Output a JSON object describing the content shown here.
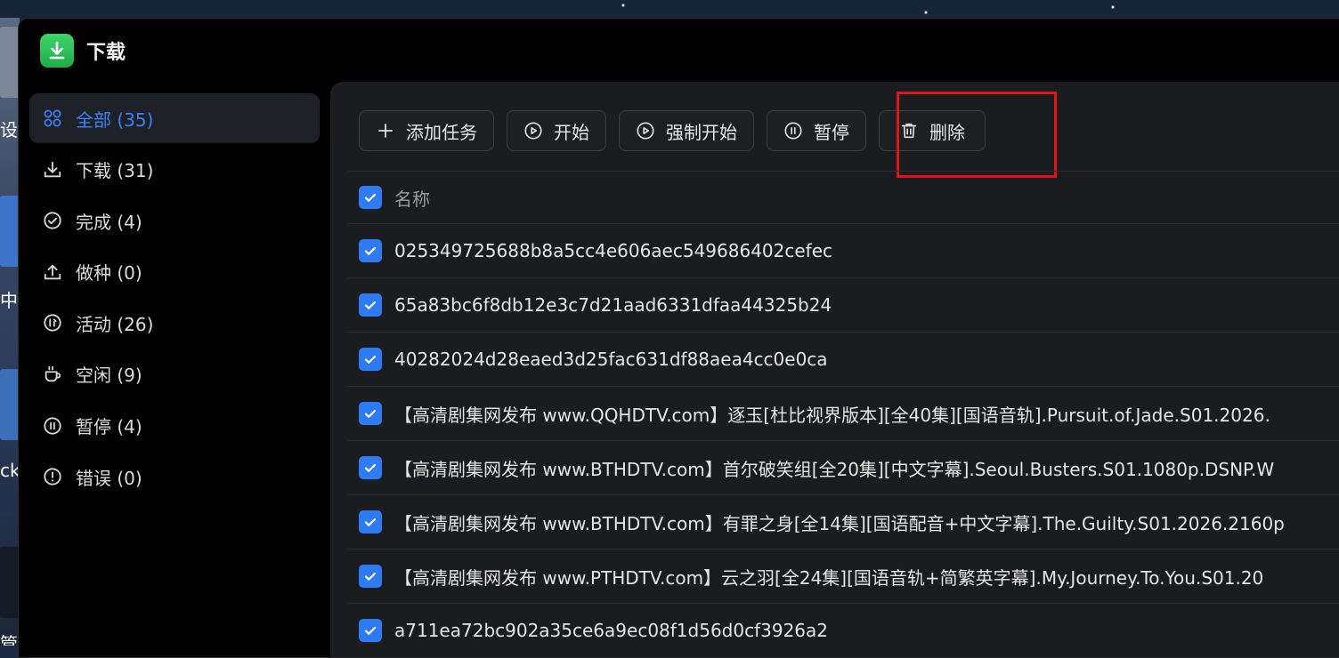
{
  "app": {
    "title": "下载"
  },
  "desktop": {
    "partial_texts": [
      "设",
      "中",
      "ck",
      "管"
    ]
  },
  "sidebar": {
    "items": [
      {
        "label": "全部 (35)",
        "icon": "grid-icon",
        "active": true
      },
      {
        "label": "下载 (31)",
        "icon": "download-icon",
        "active": false
      },
      {
        "label": "完成 (4)",
        "icon": "check-circle-icon",
        "active": false
      },
      {
        "label": "做种 (0)",
        "icon": "upload-icon",
        "active": false
      },
      {
        "label": "活动 (26)",
        "icon": "activity-icon",
        "active": false
      },
      {
        "label": "空闲 (9)",
        "icon": "coffee-cup-icon",
        "active": false
      },
      {
        "label": "暂停 (4)",
        "icon": "pause-circle-icon",
        "active": false
      },
      {
        "label": "错误 (0)",
        "icon": "alert-circle-icon",
        "active": false
      }
    ]
  },
  "toolbar": {
    "add_label": "添加任务",
    "start_label": "开始",
    "force_start_label": "强制开始",
    "pause_label": "暂停",
    "delete_label": "删除"
  },
  "table": {
    "header": "名称",
    "rows": [
      "025349725688b8a5cc4e606aec549686402cefec",
      "65a83bc6f8db12e3c7d21aad6331dfaa44325b24",
      "40282024d28eaed3d25fac631df88aea4cc0e0ca",
      "【高清剧集网发布 www.QQHDTV.com】逐玉[杜比视界版本][全40集][国语音轨].Pursuit.of.Jade.S01.2026.",
      "【高清剧集网发布 www.BTHDTV.com】首尔破笑组[全20集][中文字幕].Seoul.Busters.S01.1080p.DSNP.W",
      "【高清剧集网发布 www.BTHDTV.com】有罪之身[全14集][国语配音+中文字幕].The.Guilty.S01.2026.2160p",
      "【高清剧集网发布 www.PTHDTV.com】云之羽[全24集][国语音轨+简繁英字幕].My.Journey.To.You.S01.20",
      "a711ea72bc902a35ce6a9ec08f1d56d0cf3926a2"
    ]
  },
  "colors": {
    "accent": "#2f7bf5",
    "highlight": "#e11515",
    "app_icon": "#2fc25b"
  }
}
